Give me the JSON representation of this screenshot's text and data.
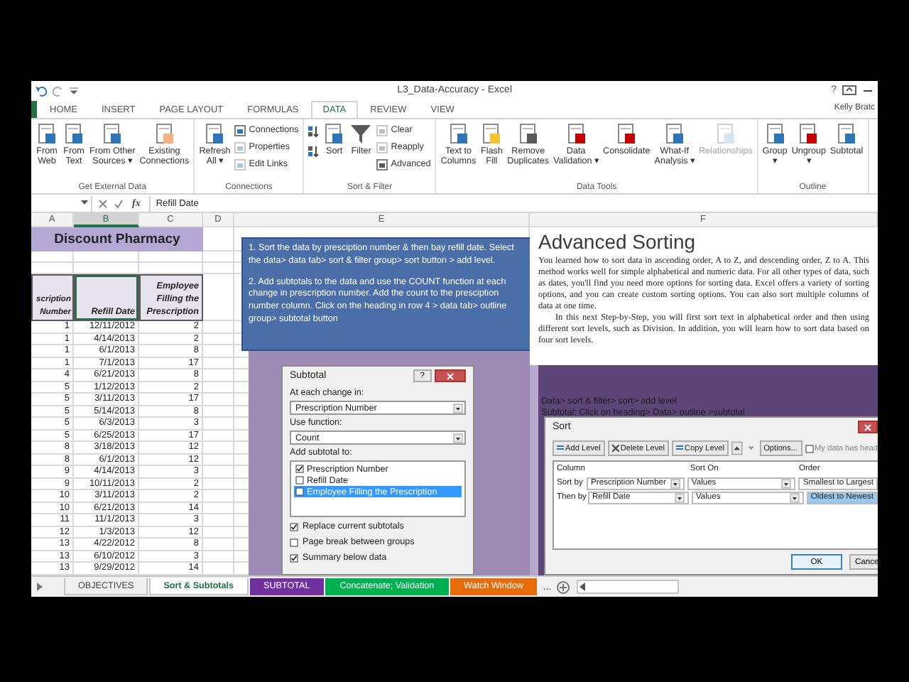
{
  "window": {
    "title": "L3_Data-Accuracy - Excel",
    "help": "?",
    "user": "Kelly Bratc"
  },
  "ribbon_tabs": [
    {
      "label": "HOME",
      "selected": false
    },
    {
      "label": "INSERT",
      "selected": false
    },
    {
      "label": "PAGE LAYOUT",
      "selected": false
    },
    {
      "label": "FORMULAS",
      "selected": false
    },
    {
      "label": "DATA",
      "selected": true
    },
    {
      "label": "REVIEW",
      "selected": false
    },
    {
      "label": "VIEW",
      "selected": false
    }
  ],
  "ribbon_groups": [
    {
      "label": "Get External Data",
      "items": [
        {
          "kind": "large",
          "label": "From\nWeb",
          "disabled": false
        },
        {
          "kind": "large",
          "label": "From\nText",
          "disabled": false
        },
        {
          "kind": "large",
          "label": "From Other\nSources ▾",
          "disabled": false
        },
        {
          "kind": "large",
          "label": "Existing\nConnections",
          "disabled": false
        }
      ]
    },
    {
      "label": "Connections",
      "items": [
        {
          "kind": "large",
          "label": "Refresh\nAll ▾",
          "disabled": false
        },
        {
          "kind": "stack",
          "items": [
            {
              "label": "Connections",
              "disabled": false
            },
            {
              "label": "Properties",
              "disabled": true
            },
            {
              "label": "Edit Links",
              "disabled": true
            }
          ]
        }
      ]
    },
    {
      "label": "Sort & Filter",
      "items": [
        {
          "kind": "sortpair"
        },
        {
          "kind": "large",
          "label": "Sort",
          "disabled": false
        },
        {
          "kind": "large",
          "label": "Filter",
          "disabled": false
        },
        {
          "kind": "stack",
          "items": [
            {
              "label": "Clear",
              "disabled": true
            },
            {
              "label": "Reapply",
              "disabled": true
            },
            {
              "label": "Advanced",
              "disabled": false
            }
          ]
        }
      ]
    },
    {
      "label": "Data Tools",
      "items": [
        {
          "kind": "large",
          "label": "Text to\nColumns",
          "disabled": false
        },
        {
          "kind": "large",
          "label": "Flash\nFill",
          "disabled": false
        },
        {
          "kind": "large",
          "label": "Remove\nDuplicates",
          "disabled": false
        },
        {
          "kind": "large",
          "label": "Data\nValidation ▾",
          "disabled": false
        },
        {
          "kind": "large",
          "label": "Consolidate",
          "disabled": false
        },
        {
          "kind": "large",
          "label": "What-If\nAnalysis ▾",
          "disabled": false
        },
        {
          "kind": "large",
          "label": "Relationships",
          "disabled": true
        }
      ]
    },
    {
      "label": "Outline",
      "items": [
        {
          "kind": "large",
          "label": "Group\n▾",
          "disabled": false
        },
        {
          "kind": "large",
          "label": "Ungroup\n▾",
          "disabled": false
        },
        {
          "kind": "large",
          "label": "Subtotal",
          "disabled": false
        }
      ]
    }
  ],
  "formula_bar": {
    "function_button": "fx",
    "value": "Refill Date"
  },
  "columns": [
    {
      "label": "A",
      "selected": false
    },
    {
      "label": "B",
      "selected": true
    },
    {
      "label": "C",
      "selected": false
    },
    {
      "label": "D",
      "selected": false
    },
    {
      "label": "E",
      "selected": false
    },
    {
      "label": "F",
      "selected": false
    }
  ],
  "sheet": {
    "title": "Discount Pharmacy",
    "headers": [
      "scription Number",
      "Refill Date",
      "Employee Filling the Prescription"
    ],
    "rows": [
      [
        "1",
        "12/11/2012",
        "2"
      ],
      [
        "1",
        "4/14/2013",
        "2"
      ],
      [
        "1",
        "6/1/2013",
        "8"
      ],
      [
        "1",
        "7/1/2013",
        "17"
      ],
      [
        "4",
        "6/21/2013",
        "8"
      ],
      [
        "5",
        "1/12/2013",
        "2"
      ],
      [
        "5",
        "3/11/2013",
        "17"
      ],
      [
        "5",
        "5/14/2013",
        "8"
      ],
      [
        "5",
        "6/3/2013",
        "3"
      ],
      [
        "5",
        "6/25/2013",
        "17"
      ],
      [
        "8",
        "3/18/2013",
        "12"
      ],
      [
        "8",
        "6/1/2013",
        "12"
      ],
      [
        "9",
        "4/14/2013",
        "3"
      ],
      [
        "9",
        "10/11/2013",
        "2"
      ],
      [
        "10",
        "3/11/2013",
        "2"
      ],
      [
        "10",
        "6/21/2013",
        "14"
      ],
      [
        "11",
        "11/1/2013",
        "3"
      ],
      [
        "12",
        "1/3/2013",
        "12"
      ],
      [
        "13",
        "4/22/2012",
        "8"
      ],
      [
        "13",
        "6/10/2012",
        "3"
      ],
      [
        "13",
        "9/29/2012",
        "14"
      ]
    ]
  },
  "note_box": {
    "paragraphs": [
      "1. Sort the data by presciption number & then bay refill date. Select the data> data tab> sort & filter group> sort button > add level.",
      "2. Add subtotals to the data and use the COUNT function at each change in prescription number. Add the count to the presciption number column. Click on the heading in row 4 > data tab> outline group> subtotal button"
    ]
  },
  "subtotal_dialog": {
    "title": "Subtotal",
    "help": "?",
    "change_label": "At each change in:",
    "change_value": "Prescription Number",
    "function_label": "Use function:",
    "function_value": "Count",
    "add_label": "Add subtotal to:",
    "fields": [
      {
        "label": "Prescription Number",
        "checked": true,
        "selected": false
      },
      {
        "label": "Refill Date",
        "checked": false,
        "selected": false
      },
      {
        "label": "Employee Filling the Prescription",
        "checked": false,
        "selected": true
      }
    ],
    "options": [
      {
        "label": "Replace current subtotals",
        "checked": true
      },
      {
        "label": "Page break between groups",
        "checked": false
      },
      {
        "label": "Summary below data",
        "checked": true
      }
    ]
  },
  "article": {
    "heading": "Advanced Sorting",
    "paragraphs": [
      "You learned how to sort data in ascending order, A to Z, and descending order, Z to A. This method works well for simple alphabetical and numeric data. For all other types of data, such as dates, you'll find you need more options for sorting data. Excel offers a variety of sorting options, and you can create custom sorting options. You can also sort multiple columns of data at one time.",
      "In this next Step-by-Step, you will first sort text in alphabetical order and then using different sort levels, such as Division. In addition, you will learn how to sort data based on four sort levels."
    ]
  },
  "panel_notes": [
    "Data> sort & filter> sort> add level",
    "Subtotal: Click on heading> Data> outline >subtotal"
  ],
  "sort_dialog": {
    "title": "Sort",
    "toolbar": [
      "Add Level",
      "Delete Level",
      "Copy Level",
      "Options..."
    ],
    "headers_option": {
      "label": "My data has head",
      "checked": false
    },
    "columns": [
      "Column",
      "Sort On",
      "Order"
    ],
    "levels": [
      {
        "label": "Sort by",
        "column": "Prescription Number",
        "sort_on": "Values",
        "order": "Smallest to Largest",
        "selected": false
      },
      {
        "label": "Then by",
        "column": "Refill Date",
        "sort_on": "Values",
        "order": "Oldest to Newest",
        "selected": true
      }
    ],
    "buttons": [
      "OK",
      "Cance"
    ]
  },
  "sheet_tabs": [
    {
      "label": "OBJECTIVES",
      "selected": false
    },
    {
      "label": "Sort & Subtotals",
      "selected": true
    },
    {
      "label": "SUBTOTAL",
      "selected": false,
      "color": "#7030a0"
    },
    {
      "label": "Concatenate; Validation",
      "selected": false,
      "color": "#00b050"
    },
    {
      "label": "Watch Window",
      "selected": false,
      "color": "#e46c0a"
    }
  ],
  "more_tabs": "..."
}
